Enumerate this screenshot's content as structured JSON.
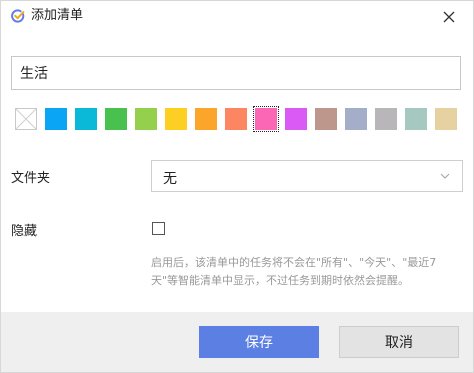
{
  "window": {
    "title": "添加清单",
    "icon": "app-check-icon"
  },
  "name_field": {
    "value": "生活"
  },
  "colors": {
    "options": [
      {
        "name": "none",
        "hex": ""
      },
      {
        "name": "blue",
        "hex": "#0aa5f5"
      },
      {
        "name": "cyan",
        "hex": "#0ab9d8"
      },
      {
        "name": "green",
        "hex": "#49c14f"
      },
      {
        "name": "light-green",
        "hex": "#95d04c"
      },
      {
        "name": "yellow",
        "hex": "#fbd023"
      },
      {
        "name": "orange",
        "hex": "#fba52b"
      },
      {
        "name": "salmon",
        "hex": "#fd8662"
      },
      {
        "name": "pink",
        "hex": "#fb67b4"
      },
      {
        "name": "purple",
        "hex": "#da5af5"
      },
      {
        "name": "brown",
        "hex": "#bd978c"
      },
      {
        "name": "slate",
        "hex": "#a4aec8"
      },
      {
        "name": "gray",
        "hex": "#b8b6b9"
      },
      {
        "name": "sage",
        "hex": "#a5c8c1"
      },
      {
        "name": "sand",
        "hex": "#e6d2a0"
      }
    ],
    "selected": "pink"
  },
  "folder": {
    "label": "文件夹",
    "value": "无"
  },
  "hidden": {
    "label": "隐藏",
    "checked": false,
    "hint": "启用后，该清单中的任务将不会在\"所有\"、\"今天\"、\"最近7天\"等智能清单中显示，不过任务到期时依然会提醒。"
  },
  "buttons": {
    "save": "保存",
    "cancel": "取消"
  },
  "theme": {
    "accent": "#5c7fe3",
    "footer_bg": "#efefef"
  }
}
